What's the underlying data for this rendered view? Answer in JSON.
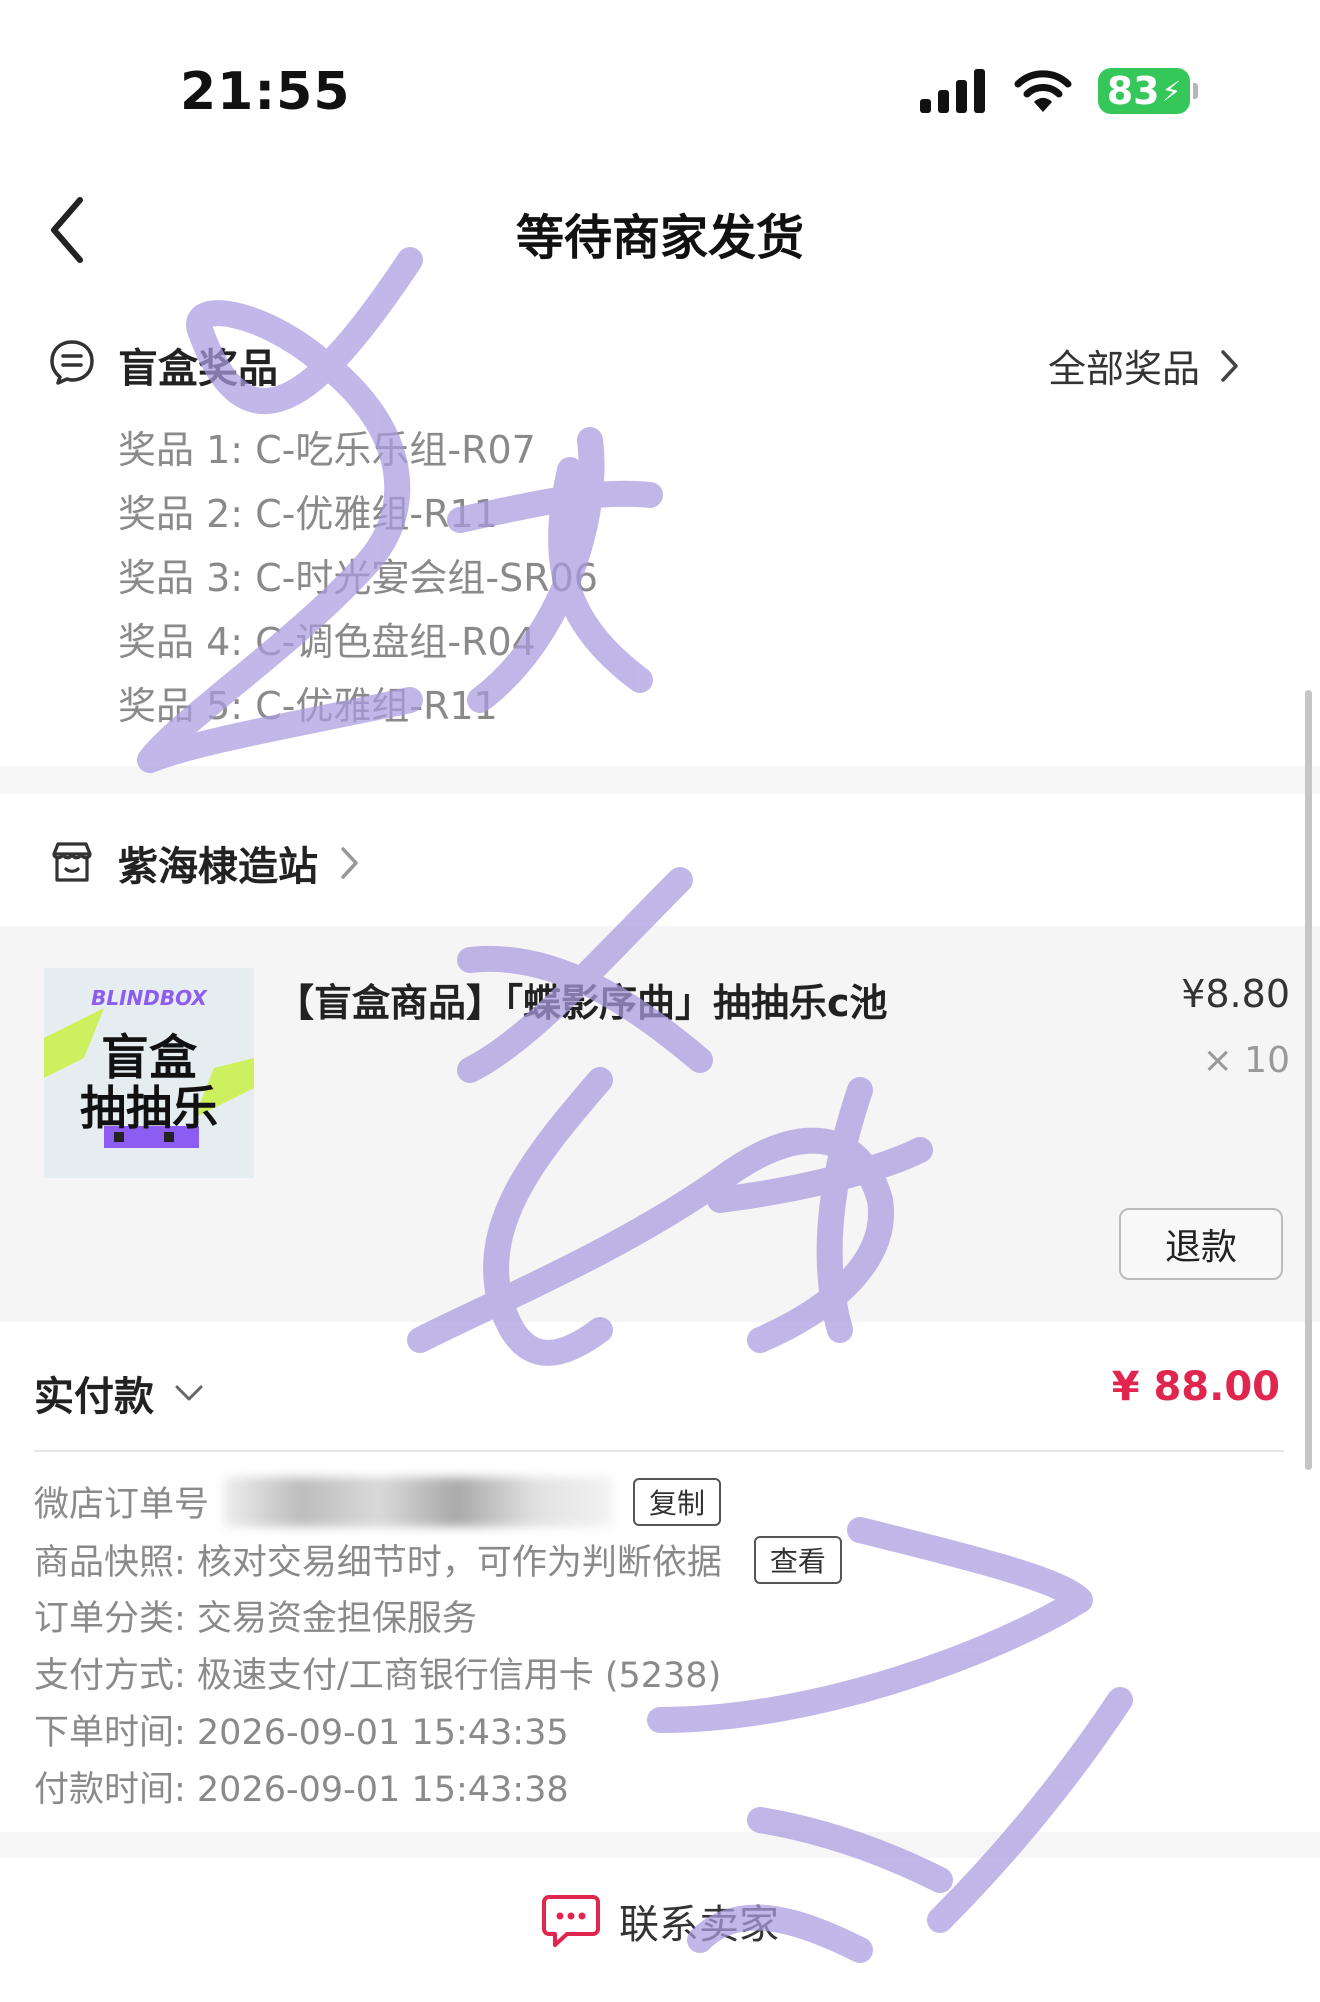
{
  "status_bar": {
    "time": "21:55",
    "battery": "83"
  },
  "nav": {
    "title": "等待商家发货"
  },
  "prizes": {
    "title": "盲盒奖品",
    "all_link": "全部奖品",
    "items": [
      "奖品 1: C-吃乐乐组-R07",
      "奖品 2: C-优雅组-R11",
      "奖品 3: C-时光宴会组-SR06",
      "奖品 4: C-调色盘组-R04",
      "奖品 5: C-优雅组-R11"
    ]
  },
  "shop": {
    "name": "紫海棣造站"
  },
  "product": {
    "thumb_brand": "BLINDBOX",
    "thumb_line1": "盲盒",
    "thumb_line2": "抽抽乐",
    "title": "【盲盒商品】「蝶影序曲」抽抽乐c池",
    "price": "¥8.80",
    "quantity": "× 10",
    "refund_label": "退款"
  },
  "payment": {
    "label": "实付款",
    "amount": "¥ 88.00"
  },
  "order_info": {
    "order_no_label": "微店订单号",
    "copy_label": "复制",
    "snapshot": "商品快照: 核对交易细节时，可作为判断依据",
    "view_label": "查看",
    "category": "订单分类:  交易资金担保服务",
    "pay_method": "支付方式:  极速支付/工商银行信用卡 (5238)",
    "order_time": "下单时间:  2026-09-01 15:43:35",
    "pay_time": "付款时间:  2026-09-01 15:43:38"
  },
  "contact": {
    "label": "联系卖家"
  },
  "colors": {
    "accent": "#e0264e",
    "battery": "#35c759",
    "watermark": "#a99be0"
  }
}
